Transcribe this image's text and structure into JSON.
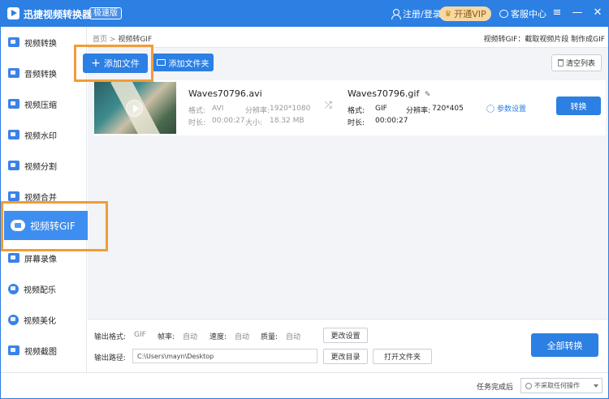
{
  "app": {
    "title": "迅捷视频转换器",
    "badge": "极速版",
    "login_label": "注册/登录",
    "vip_label": "开通VIP",
    "service_label": "客服中心",
    "menu_icon": "≡",
    "minimize_icon": "—",
    "close_icon": "✕"
  },
  "sidebar": {
    "items": [
      {
        "label": "视频转换"
      },
      {
        "label": "音频转换"
      },
      {
        "label": "视频压缩"
      },
      {
        "label": "视频水印"
      },
      {
        "label": "视频分割"
      },
      {
        "label": "视频合并"
      },
      {
        "label": "视频转GIF",
        "active": true
      },
      {
        "label": "屏幕录像"
      },
      {
        "label": "视频配乐"
      },
      {
        "label": "视频美化"
      },
      {
        "label": "视频截图"
      }
    ]
  },
  "breadcrumb": {
    "home": "首页",
    "separator": ">",
    "current": "视频转GIF"
  },
  "hint": "视频转GIF：截取视频片段 制作成GIF",
  "toolbar": {
    "add_file_label": "添加文件",
    "add_file_icon": "+",
    "add_folder_label": "添加文件夹",
    "clear_list_label": "清空列表"
  },
  "file": {
    "source_name": "Waves70796.avi",
    "source_format_label": "格式:",
    "source_format": "AVI",
    "source_resolution_label": "分辨率:",
    "source_resolution": "1920*1080",
    "source_duration_label": "时长:",
    "source_duration": "00:00:27",
    "source_size_label": "大小:",
    "source_size": "18.32 MB",
    "convert_icon": "⤮",
    "target_name": "Waves70796.gif",
    "edit_icon": "✎",
    "target_format_label": "格式:",
    "target_format": "GIF",
    "target_resolution_label": "分辨率:",
    "target_resolution": "720*405",
    "target_duration_label": "时长:",
    "target_duration": "00:00:27",
    "settings_label": "参数设置",
    "convert_label": "转换"
  },
  "output": {
    "format_label": "输出格式:",
    "format_value": "GIF",
    "fps_label": "帧率:",
    "fps_value": "自动",
    "speed_label": "速度:",
    "speed_value": "自动",
    "quality_label": "质量:",
    "quality_value": "自动",
    "change_settings_label": "更改设置",
    "path_label": "输出路径:",
    "path_value": "C:\\Users\\mayn\\Desktop",
    "change_dir_label": "更改目录",
    "open_folder_label": "打开文件夹",
    "convert_all_label": "全部转换"
  },
  "status": {
    "after_task_label": "任务完成后",
    "after_task_value": "不采取任何操作"
  },
  "colors": {
    "primary": "#2c7fe3",
    "highlight": "#f19c38",
    "vip": "#f6d8a3"
  }
}
